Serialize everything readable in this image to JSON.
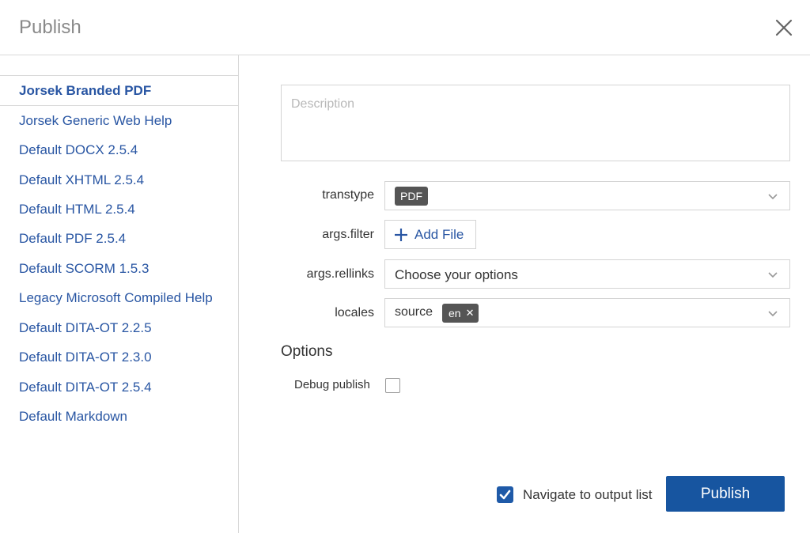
{
  "dialog": {
    "title": "Publish"
  },
  "sidebar": {
    "items": [
      {
        "label": "Jorsek Branded PDF",
        "active": true
      },
      {
        "label": "Jorsek Generic Web Help"
      },
      {
        "label": "Default DOCX 2.5.4"
      },
      {
        "label": "Default XHTML 2.5.4"
      },
      {
        "label": "Default HTML 2.5.4"
      },
      {
        "label": "Default PDF 2.5.4"
      },
      {
        "label": "Default SCORM 1.5.3"
      },
      {
        "label": "Legacy Microsoft Compiled Help"
      },
      {
        "label": "Default DITA-OT 2.2.5"
      },
      {
        "label": "Default DITA-OT 2.3.0"
      },
      {
        "label": "Default DITA-OT 2.5.4"
      },
      {
        "label": "Default Markdown"
      }
    ]
  },
  "form": {
    "description_placeholder": "Description",
    "transtype": {
      "label": "transtype",
      "value": "PDF"
    },
    "args_filter": {
      "label": "args.filter",
      "button": "Add File"
    },
    "args_rellinks": {
      "label": "args.rellinks",
      "placeholder": "Choose your options"
    },
    "locales": {
      "label": "locales",
      "source": "source",
      "tag": "en"
    },
    "options_heading": "Options",
    "debug_publish": {
      "label": "Debug publish",
      "checked": false
    }
  },
  "footer": {
    "navigate_label": "Navigate to output list",
    "navigate_checked": true,
    "publish_button": "Publish"
  },
  "colors": {
    "accent": "#1755a0",
    "link": "#2956a3",
    "tag_bg": "#555555"
  }
}
